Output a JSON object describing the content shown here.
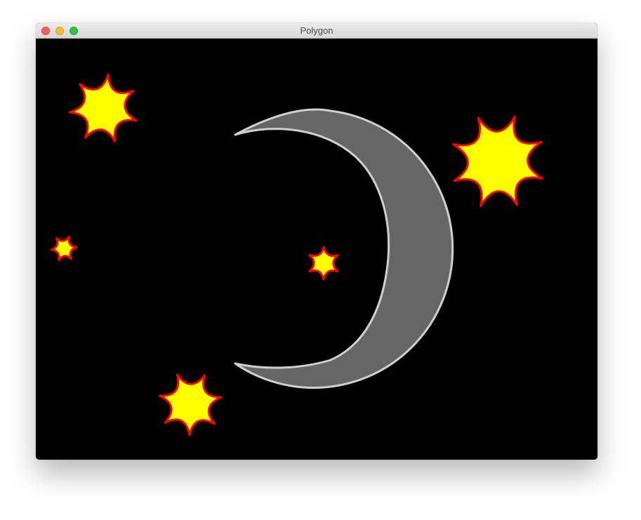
{
  "window": {
    "title": "Polygon"
  },
  "scene": {
    "background_color": "#000000",
    "moon": {
      "fill": "#666666",
      "stroke": "#d0d0d0"
    },
    "star_style": {
      "fill": "#ffff00",
      "stroke": "#ff0000"
    },
    "stars": [
      {
        "name": "star-top-left"
      },
      {
        "name": "star-top-right"
      },
      {
        "name": "star-small-left"
      },
      {
        "name": "star-center"
      },
      {
        "name": "star-bottom"
      }
    ]
  }
}
